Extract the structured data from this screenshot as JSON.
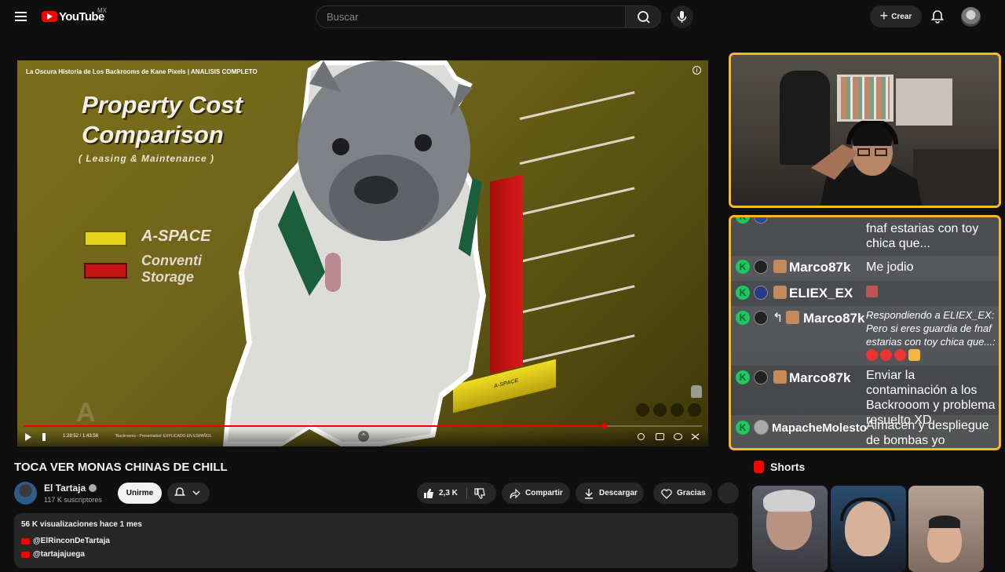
{
  "header": {
    "logo_text": "YouTube",
    "region": "MX",
    "search_placeholder": "Buscar",
    "create_label": "Crear"
  },
  "player": {
    "title": "La Oscura Historia de Los Backrooms de Kane Pixels | ANALISIS COMPLETO",
    "scene_title_line1": "Property Cost",
    "scene_title_line2": "Comparison",
    "scene_subtitle": "( Leasing & Maintenance )",
    "legend_1": "A-SPACE",
    "legend_2_line1": "Conventi",
    "legend_2_line2": "Storage",
    "bar_label": "A-SPACE",
    "time": "1:28:52 / 1:43:56",
    "chapter": "'Backrooms - Presentation' EXPLICADO EN ESPAÑOL",
    "progress_fraction": 0.855
  },
  "chat": {
    "rows": [
      {
        "user": "",
        "message": "fnaf estarias con toy chica que..."
      },
      {
        "user": "Marco87k",
        "message": "Me jodio"
      },
      {
        "user": "ELIEX_EX",
        "message": ""
      },
      {
        "user": "Marco87k",
        "message": "Respondiendo a ELIEX_EX: Pero si eres guardia de fnaf estarias con toy chica que...:"
      },
      {
        "user": "Marco87k",
        "message": "Enviar la contaminación a los Backrooom y problema resuelto XD"
      },
      {
        "user": "MapacheMolesto",
        "message": "Almacen y despliegue de bombas yo escucheé"
      }
    ]
  },
  "video": {
    "title": "TOCA VER MONAS CHINAS DE CHILL",
    "channel": "El Tartaja",
    "subscribers": "117 K suscriptores",
    "join_label": "Unirme",
    "likes": "2,3 K",
    "share_label": "Compartir",
    "download_label": "Descargar",
    "thanks_label": "Gracias"
  },
  "description": {
    "meta": "56 K visualizaciones  hace 1 mes",
    "links": [
      "@ElRinconDeTartaja",
      "@tartajajuega"
    ]
  },
  "shorts": {
    "heading": "Shorts"
  }
}
